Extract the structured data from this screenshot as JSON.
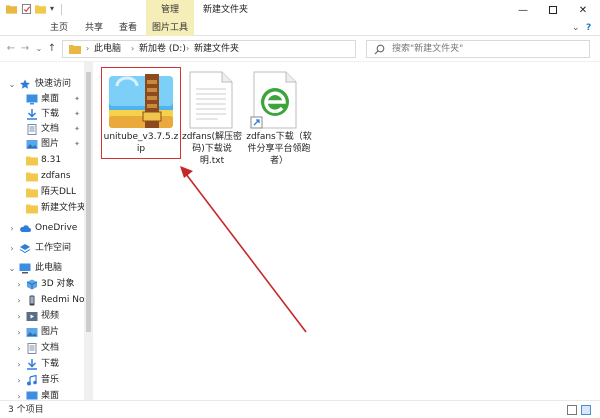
{
  "window": {
    "title": "新建文件夹",
    "manage_tab": "管理"
  },
  "ribbon": {
    "tabs": [
      "文件",
      "主页",
      "共享",
      "查看",
      "图片工具"
    ]
  },
  "address": {
    "crumbs": [
      "此电脑",
      "新加卷 (D:)",
      "新建文件夹"
    ]
  },
  "search": {
    "placeholder": "搜索\"新建文件夹\""
  },
  "nav": {
    "items": [
      {
        "label": "快速访问",
        "icon": "star-icon"
      },
      {
        "label": "桌面",
        "icon": "desktop-icon",
        "pinned": true
      },
      {
        "label": "下载",
        "icon": "download-icon",
        "pinned": true
      },
      {
        "label": "文档",
        "icon": "document-icon",
        "pinned": true
      },
      {
        "label": "图片",
        "icon": "picture-icon",
        "pinned": true
      },
      {
        "label": "8.31",
        "icon": "folder-icon"
      },
      {
        "label": "zdfans",
        "icon": "folder-icon"
      },
      {
        "label": "陌天DLL",
        "icon": "folder-icon"
      },
      {
        "label": "新建文件夹",
        "icon": "folder-icon"
      },
      {
        "label": "OneDrive",
        "icon": "cloud-icon"
      },
      {
        "label": "工作空间",
        "icon": "workspace-icon"
      },
      {
        "label": "此电脑",
        "icon": "computer-icon"
      },
      {
        "label": "3D 对象",
        "icon": "cube-icon"
      },
      {
        "label": "Redmi Note",
        "icon": "phone-icon"
      },
      {
        "label": "视频",
        "icon": "video-icon"
      },
      {
        "label": "图片",
        "icon": "picture-icon"
      },
      {
        "label": "文档",
        "icon": "document-icon"
      },
      {
        "label": "下载",
        "icon": "download-icon"
      },
      {
        "label": "音乐",
        "icon": "music-icon"
      },
      {
        "label": "桌面",
        "icon": "desktop-icon"
      }
    ]
  },
  "files": [
    {
      "name": "unitube_v3.7.5.zip",
      "line1": "unitube_v3.7.5.z",
      "line2": "ip",
      "icon": "archive-icon",
      "selected": true
    },
    {
      "name": "zdfans(解压密码)下载说明.txt",
      "line1": "zdfans(解压密",
      "line2": "码)下载说明.txt",
      "icon": "text-file-icon"
    },
    {
      "name": "zdfans下载（软件分享平台领跑者）",
      "line1": "zdfans下载（软",
      "line2": "件分享平台领跑",
      "line3": "者）",
      "icon": "ie-shortcut-icon"
    }
  ],
  "status": {
    "text": "3 个项目"
  },
  "colors": {
    "accent": "#1979ca",
    "manage_tab": "#f5eeb8",
    "selection_border": "#d33333",
    "arrow": "#c62828"
  }
}
